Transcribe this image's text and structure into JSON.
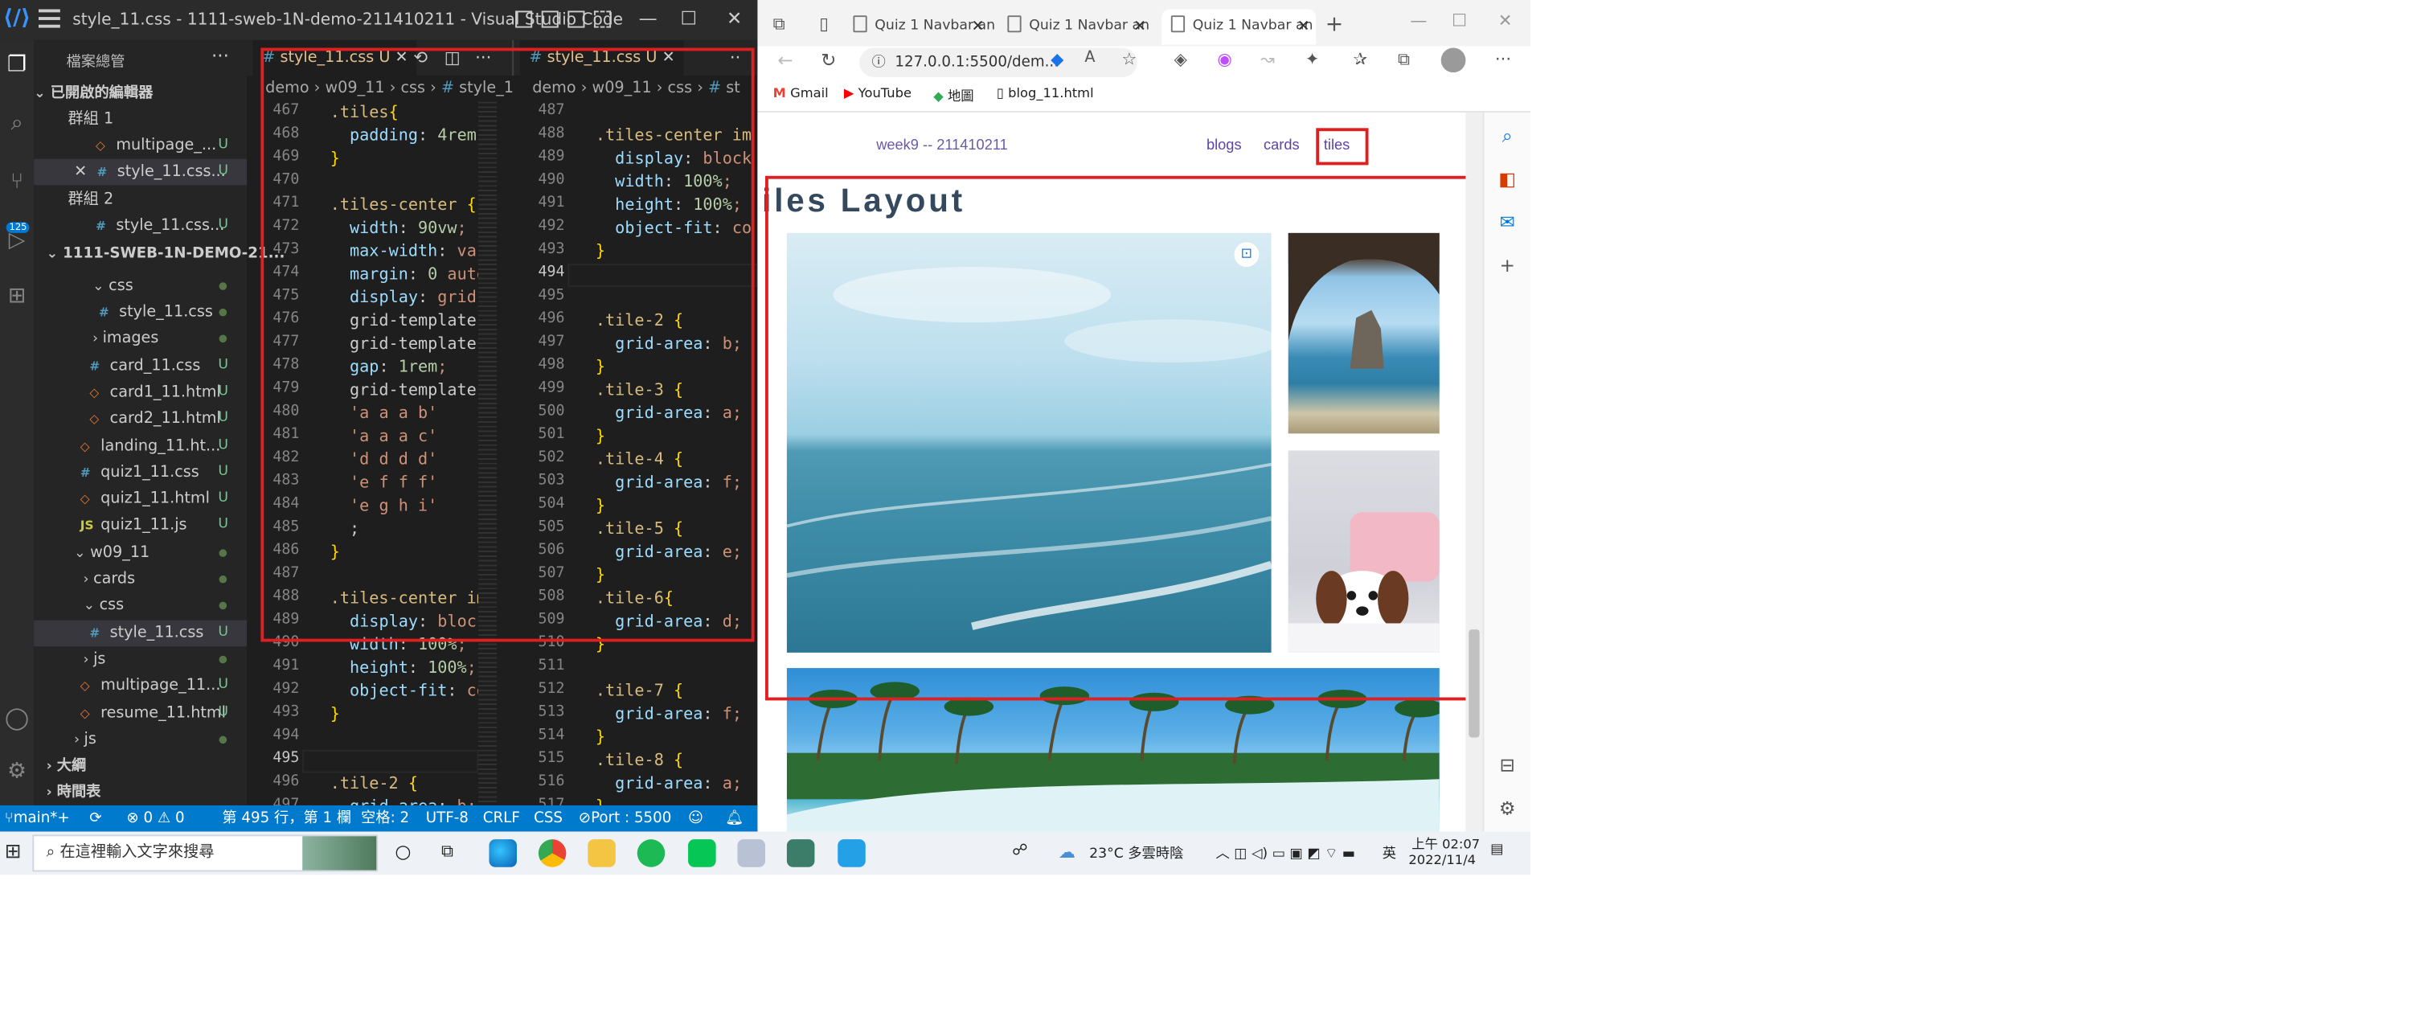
{
  "vscode": {
    "window_title": "style_11.css - 1111-sweb-1N-demo-211410211 - Visual Studio Code",
    "explorer_title": "檔案總管",
    "open_editors_header": "已開啟的編輯器",
    "group1_label": "群組 1",
    "group2_label": "群組 2",
    "project_header": "1111-SWEB-1N-DEMO-21...",
    "open_editors": [
      {
        "name": "multipage_...",
        "status": "U"
      },
      {
        "name": "style_11.css...",
        "status": "U"
      },
      {
        "name": "style_11.css...",
        "status": "U"
      }
    ],
    "tree": [
      {
        "name": "css",
        "status": ""
      },
      {
        "name": "style_11.css",
        "status": ""
      },
      {
        "name": "images",
        "status": ""
      },
      {
        "name": "card_11.css",
        "status": "U"
      },
      {
        "name": "card1_11.html",
        "status": "U"
      },
      {
        "name": "card2_11.html",
        "status": "U"
      },
      {
        "name": "landing_11.ht...",
        "status": "U"
      },
      {
        "name": "quiz1_11.css",
        "status": "U"
      },
      {
        "name": "quiz1_11.html",
        "status": "U"
      },
      {
        "name": "quiz1_11.js",
        "status": "U"
      },
      {
        "name": "w09_11",
        "status": ""
      },
      {
        "name": "cards",
        "status": ""
      },
      {
        "name": "css",
        "status": ""
      },
      {
        "name": "style_11.css",
        "status": "U"
      },
      {
        "name": "js",
        "status": ""
      },
      {
        "name": "multipage_11...",
        "status": "U"
      },
      {
        "name": "resume_11.html",
        "status": "U"
      },
      {
        "name": "js",
        "status": ""
      }
    ],
    "outline_label": "大綱",
    "timeline_label": "時間表",
    "badge_count": "125",
    "tab_left": "style_11.css",
    "tab_right": "style_11.css",
    "tab_status": "U",
    "breadcrumb_left": [
      "demo",
      "w09_11",
      "css",
      "style_1"
    ],
    "breadcrumb_right": [
      "demo",
      "w09_11",
      "css",
      "st"
    ],
    "left_lines": [
      {
        "n": "467",
        "t": ".tiles{"
      },
      {
        "n": "468",
        "t": "  padding: 4rem"
      },
      {
        "n": "469",
        "t": "}"
      },
      {
        "n": "470",
        "t": ""
      },
      {
        "n": "471",
        "t": ".tiles-center {"
      },
      {
        "n": "472",
        "t": "  width: 90vw;"
      },
      {
        "n": "473",
        "t": "  max-width: var"
      },
      {
        "n": "474",
        "t": "  margin: 0 auto"
      },
      {
        "n": "475",
        "t": "  display: grid;"
      },
      {
        "n": "476",
        "t": "  grid-template-"
      },
      {
        "n": "477",
        "t": "  grid-template-"
      },
      {
        "n": "478",
        "t": "  gap: 1rem;"
      },
      {
        "n": "479",
        "t": "  grid-template-"
      },
      {
        "n": "480",
        "t": "  'a a a b'"
      },
      {
        "n": "481",
        "t": "  'a a a c'"
      },
      {
        "n": "482",
        "t": "  'd d d d'"
      },
      {
        "n": "483",
        "t": "  'e f f f'"
      },
      {
        "n": "484",
        "t": "  'e g h i'"
      },
      {
        "n": "485",
        "t": "  ;"
      },
      {
        "n": "486",
        "t": "}"
      },
      {
        "n": "487",
        "t": ""
      },
      {
        "n": "488",
        "t": ".tiles-center im"
      },
      {
        "n": "489",
        "t": "  display: block"
      },
      {
        "n": "490",
        "t": "  width: 100%;"
      },
      {
        "n": "491",
        "t": "  height: 100%;"
      },
      {
        "n": "492",
        "t": "  object-fit: co"
      },
      {
        "n": "493",
        "t": "}"
      },
      {
        "n": "494",
        "t": ""
      },
      {
        "n": "495",
        "t": ""
      },
      {
        "n": "496",
        "t": ".tile-2 {"
      },
      {
        "n": "497",
        "t": "  grid-area: b;"
      }
    ],
    "right_lines": [
      {
        "n": "487",
        "t": ""
      },
      {
        "n": "488",
        "t": ".tiles-center im"
      },
      {
        "n": "489",
        "t": "  display: block"
      },
      {
        "n": "490",
        "t": "  width: 100%;"
      },
      {
        "n": "491",
        "t": "  height: 100%;"
      },
      {
        "n": "492",
        "t": "  object-fit: co"
      },
      {
        "n": "493",
        "t": "}"
      },
      {
        "n": "494",
        "t": ""
      },
      {
        "n": "495",
        "t": ""
      },
      {
        "n": "496",
        "t": ".tile-2 {"
      },
      {
        "n": "497",
        "t": "  grid-area: b;"
      },
      {
        "n": "498",
        "t": "}"
      },
      {
        "n": "499",
        "t": ".tile-3 {"
      },
      {
        "n": "500",
        "t": "  grid-area: a;"
      },
      {
        "n": "501",
        "t": "}"
      },
      {
        "n": "502",
        "t": ".tile-4 {"
      },
      {
        "n": "503",
        "t": "  grid-area: f;"
      },
      {
        "n": "504",
        "t": "}"
      },
      {
        "n": "505",
        "t": ".tile-5 {"
      },
      {
        "n": "506",
        "t": "  grid-area: e;"
      },
      {
        "n": "507",
        "t": "}"
      },
      {
        "n": "508",
        "t": ".tile-6{"
      },
      {
        "n": "509",
        "t": "  grid-area: d;"
      },
      {
        "n": "510",
        "t": "}"
      },
      {
        "n": "511",
        "t": ""
      },
      {
        "n": "512",
        "t": ".tile-7 {"
      },
      {
        "n": "513",
        "t": "  grid-area: f;"
      },
      {
        "n": "514",
        "t": "}"
      },
      {
        "n": "515",
        "t": ".tile-8 {"
      },
      {
        "n": "516",
        "t": "  grid-area: a;"
      },
      {
        "n": "517",
        "t": "}"
      }
    ],
    "current_line_left": "495",
    "current_line_right": "494",
    "status": {
      "branch": "main*+",
      "problems": "⊗ 0 ⚠ 0",
      "cursor": "第 495 行，第 1 欄",
      "spaces": "空格: 2",
      "encoding": "UTF-8",
      "eol": "CRLF",
      "language": "CSS",
      "port": "Port : 5500"
    }
  },
  "browser": {
    "tabs": [
      "Quiz 1 Navbar an",
      "Quiz 1 Navbar an",
      "Quiz 1 Navbar an"
    ],
    "address": "127.0.0.1:5500/dem...",
    "bookmarks": [
      "Gmail",
      "YouTube",
      "地圖",
      "blog_11.html"
    ],
    "page": {
      "brand": "week9 -- 211410211",
      "nav": [
        "blogs",
        "cards",
        "tiles"
      ],
      "heading": "iles Layout"
    }
  },
  "taskbar": {
    "search_placeholder": "在這裡輸入文字來搜尋",
    "weather": "23°C 多雲時陰",
    "ime": "英",
    "time": "上午 02:07",
    "date": "2022/11/4"
  }
}
